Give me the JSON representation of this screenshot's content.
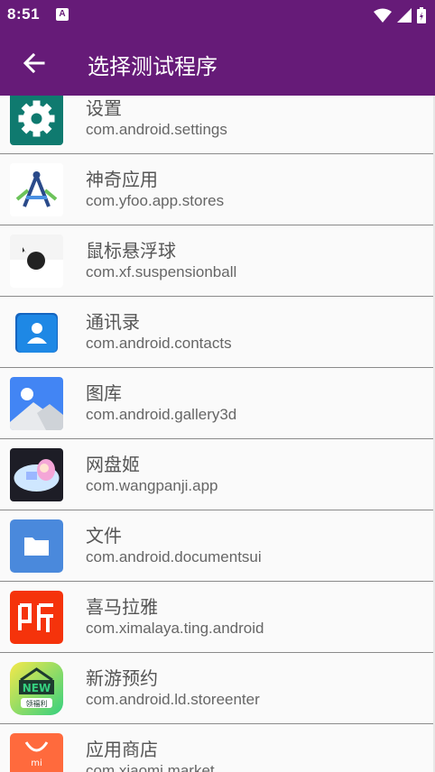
{
  "status_bar": {
    "time": "8:51",
    "notification_letter": "A"
  },
  "app_bar": {
    "title": "选择测试程序"
  },
  "colors": {
    "accent": "#661b78"
  },
  "apps": [
    {
      "name": "设置",
      "package": "com.android.settings",
      "icon": "settings-gear-icon"
    },
    {
      "name": "神奇应用",
      "package": "com.yfoo.app.stores",
      "icon": "compass-app-icon"
    },
    {
      "name": "鼠标悬浮球",
      "package": "com.xf.suspensionball",
      "icon": "mouse-ball-icon"
    },
    {
      "name": "通讯录",
      "package": "com.android.contacts",
      "icon": "contacts-icon"
    },
    {
      "name": "图库",
      "package": "com.android.gallery3d",
      "icon": "gallery-icon"
    },
    {
      "name": "网盘姬",
      "package": "com.wangpanji.app",
      "icon": "anime-girl-icon"
    },
    {
      "name": "文件",
      "package": "com.android.documentsui",
      "icon": "folder-icon"
    },
    {
      "name": "喜马拉雅",
      "package": "com.ximalaya.ting.android",
      "icon": "ximalaya-icon"
    },
    {
      "name": "新游预约",
      "package": "com.android.ld.storeenter",
      "icon": "new-game-icon",
      "icon_text": {
        "new": "NEW",
        "sub": "领福利"
      }
    },
    {
      "name": "应用商店",
      "package": "com.xiaomi.market",
      "icon": "mi-store-icon",
      "icon_text": {
        "mi": "mi"
      }
    }
  ]
}
